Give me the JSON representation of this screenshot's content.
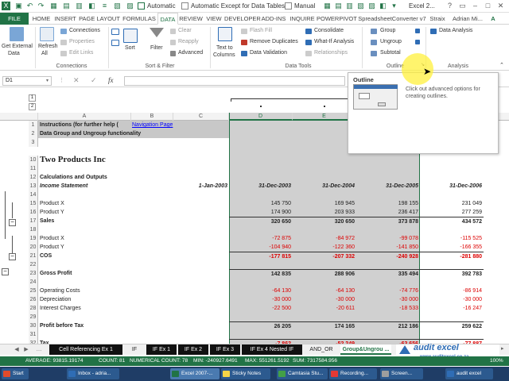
{
  "titlebar": {
    "automatic_label": "Automatic",
    "automatic_except_label": "Automatic Except for Data Tables",
    "manual_label": "Manual",
    "window_title": "Excel 2..."
  },
  "tabs": [
    "FILE",
    "HOME",
    "INSERT",
    "PAGE LAYOUT",
    "FORMULAS",
    "DATA",
    "REVIEW",
    "VIEW",
    "DEVELOPER",
    "ADD-INS",
    "INQUIRE",
    "POWERPIVOT",
    "SpreadsheetConverter v7",
    "Straix",
    "Adrian Mi..."
  ],
  "ribbon": {
    "get_external": "Get External",
    "get_external2": "Data",
    "refresh": "Refresh",
    "refresh2": "All",
    "connections": "Connections",
    "properties": "Properties",
    "edit_links": "Edit Links",
    "group_connections": "Connections",
    "sort": "Sort",
    "filter": "Filter",
    "clear": "Clear",
    "reapply": "Reapply",
    "advanced": "Advanced",
    "group_sortfilter": "Sort & Filter",
    "text_to_columns": "Text to",
    "text_to_columns2": "Columns",
    "flash_fill": "Flash Fill",
    "remove_duplicates": "Remove Duplicates",
    "data_validation": "Data Validation",
    "consolidate": "Consolidate",
    "what_if": "What-If Analysis",
    "relationships": "Relationships",
    "group_datatools": "Data Tools",
    "group_btn": "Group",
    "ungroup_btn": "Ungroup",
    "subtotal": "Subtotal",
    "group_outline": "Outline",
    "data_analysis": "Data Analysis",
    "group_analysis": "Analysis"
  },
  "formula_bar": {
    "name_box": "D1",
    "fx": "fx",
    "formula": ""
  },
  "tooltip": {
    "title": "Outline",
    "description": "Click out advanced options for creating outlines."
  },
  "outline_levels": [
    "1",
    "2",
    "3"
  ],
  "outline_row_levels": [
    "1",
    "2"
  ],
  "columns": [
    "A",
    "B",
    "C",
    "D",
    "E",
    "F",
    "G"
  ],
  "rows": [
    {
      "n": "1",
      "a": "Instructions (for further help (",
      "link": "Navigation Page",
      "style": "hdr"
    },
    {
      "n": "2",
      "a": "Data Group and Ungroup functionality",
      "style": "hdr"
    },
    {
      "n": "3"
    },
    {
      "n": "10",
      "a": "Two Products Inc",
      "style": "title"
    },
    {
      "n": "11"
    },
    {
      "n": "12",
      "a": "Calculations and Outputs",
      "style": "bold"
    },
    {
      "n": "13",
      "a": "Income Statement",
      "c": "1-Jan-2003",
      "d": "31-Dec-2003",
      "e": "31-Dec-2004",
      "f": "31-Dec-2005",
      "g": "31-Dec-2006",
      "style": "bi"
    },
    {
      "n": "14"
    },
    {
      "n": "15",
      "a": "Product X",
      "d": "145 750",
      "e": "169 945",
      "f": "198 155",
      "g": "231 049"
    },
    {
      "n": "16",
      "a": "Product Y",
      "d": "174 900",
      "e": "203 933",
      "f": "236 417",
      "g": "277 259"
    },
    {
      "n": "17",
      "a": "Sales",
      "d": "320 650",
      "e": "320 650",
      "f": "373 878",
      "g": "434 572",
      "style": "bold"
    },
    {
      "n": "18"
    },
    {
      "n": "19",
      "a": "Product X",
      "d": "-72 875",
      "e": "-84 972",
      "f": "-99 078",
      "g": "-115 525",
      "neg": true
    },
    {
      "n": "20",
      "a": "Product Y",
      "d": "-104 940",
      "e": "-122 360",
      "f": "-141 850",
      "g": "-166 355",
      "neg": true
    },
    {
      "n": "21",
      "a": "COS",
      "d": "-177 815",
      "e": "-207 332",
      "f": "-240 928",
      "g": "-281 880",
      "style": "bold",
      "neg": true
    },
    {
      "n": "22"
    },
    {
      "n": "23",
      "a": "Gross Profit",
      "d": "142 835",
      "e": "288 906",
      "f": "335 494",
      "g": "392 783",
      "style": "bold"
    },
    {
      "n": "24"
    },
    {
      "n": "25",
      "a": "Operating Costs",
      "d": "-64 130",
      "e": "-64 130",
      "f": "-74 776",
      "g": "-86 914",
      "neg": true
    },
    {
      "n": "26",
      "a": "Depreciation",
      "d": "-30 000",
      "e": "-30 000",
      "f": "-30 000",
      "g": "-30 000",
      "neg": true
    },
    {
      "n": "28",
      "a": "Interest Charges",
      "d": "-22 500",
      "e": "-20 611",
      "f": "-18 533",
      "g": "-16 247",
      "neg": true
    },
    {
      "n": "29"
    },
    {
      "n": "30",
      "a": "Profit before Tax",
      "d": "26 205",
      "e": "174 165",
      "f": "212 186",
      "g": "259 622",
      "style": "bold"
    },
    {
      "n": "31"
    },
    {
      "n": "32",
      "a": "Tax",
      "d": "-7 862",
      "e": "-52 249",
      "f": "-63 656",
      "g": "-77 887",
      "style": "bold",
      "neg": true
    }
  ],
  "sheet_tabs": [
    "Cell Referencing Ex 1",
    "IF",
    "IF Ex 1",
    "IF Ex 2",
    "IF Ex 3",
    "IF Ex 4 Nested IF",
    "AND_OR",
    "Group&Ungrou ..."
  ],
  "logo": {
    "name": "audit excel",
    "url": "www.auditexcel.co.za"
  },
  "status": {
    "average": "AVERAGE: 93815.19174",
    "count": "COUNT: 81",
    "numerical_count": "NUMERICAL COUNT: 78",
    "min": "MIN: -240927.6491",
    "max": "MAX: 551261.5192",
    "sum": "SUM: 7317584.956",
    "zoom": "100%"
  },
  "taskbar": [
    "Start",
    "Inbox - adria...",
    "Excel 2007-...",
    "Sticky Notes",
    "Camtasia Stu...",
    "Recording...",
    "Screen...",
    "audit excel"
  ],
  "colors": {
    "excel_green": "#217346",
    "negative_red": "#dd0000",
    "link_blue": "#0000ff",
    "taskbar_blue": "#1f3d66"
  }
}
